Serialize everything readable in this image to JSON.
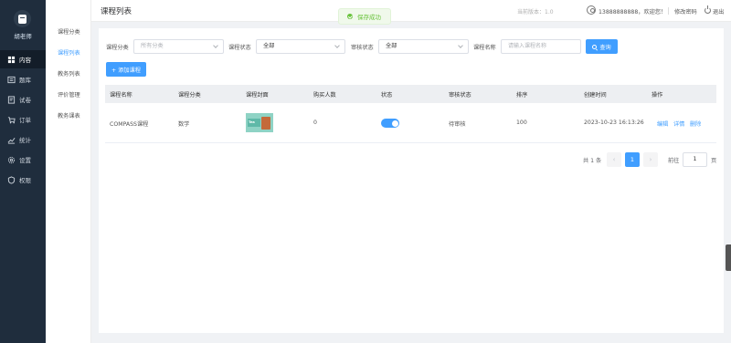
{
  "sidebar": {
    "brand": "胡老师",
    "items": [
      {
        "label": "内容",
        "icon": "content-icon",
        "active": true
      },
      {
        "label": "题库",
        "icon": "question-bank-icon",
        "active": false
      },
      {
        "label": "试卷",
        "icon": "exam-paper-icon",
        "active": false
      },
      {
        "label": "订单",
        "icon": "order-icon",
        "active": false
      },
      {
        "label": "统计",
        "icon": "statistics-icon",
        "active": false
      },
      {
        "label": "设置",
        "icon": "settings-icon",
        "active": false
      },
      {
        "label": "权限",
        "icon": "permission-icon",
        "active": false
      }
    ]
  },
  "submenu": {
    "items": [
      {
        "label": "课程分类",
        "active": false
      },
      {
        "label": "课程列表",
        "active": true
      },
      {
        "label": "教务列表",
        "active": false
      },
      {
        "label": "评价管理",
        "active": false
      },
      {
        "label": "教务课表",
        "active": false
      }
    ]
  },
  "header": {
    "title": "课程列表",
    "version": "当前版本：1.0",
    "user": "13888888888，欢迎您！",
    "change_password": "修改密码",
    "logout": "退出"
  },
  "toast": {
    "text": "保存成功",
    "color": "#67c23a"
  },
  "filters": {
    "category_label": "课程分类",
    "category_placeholder": "所有分类",
    "status_label": "课程状态",
    "status_value": "全部",
    "audit_label": "审核状态",
    "audit_value": "全部",
    "name_label": "课程名称",
    "name_placeholder": "请输入课程名称",
    "search_button": "查询"
  },
  "add_button": "+ 添加课程",
  "table": {
    "headers": [
      "课程名称",
      "课程分类",
      "课程封面",
      "购买人数",
      "状态",
      "审核状态",
      "排序",
      "创建时间",
      "操作"
    ],
    "rows": [
      {
        "name": "COMPASS课程",
        "category": "数学",
        "cover_text": "Tea",
        "buyers": "0",
        "status_on": true,
        "audit": "待审核",
        "sort": "100",
        "created": "2023-10-23 16:13:26",
        "actions": [
          "编辑",
          "详情",
          "删除"
        ]
      }
    ]
  },
  "pagination": {
    "total": "共 1 条",
    "prev": "‹",
    "current": "1",
    "next": "›",
    "goto_label": "前往",
    "goto_value": "1",
    "unit": "页"
  },
  "colors": {
    "accent": "#409eff",
    "sidebar": "#1f2d3d"
  }
}
